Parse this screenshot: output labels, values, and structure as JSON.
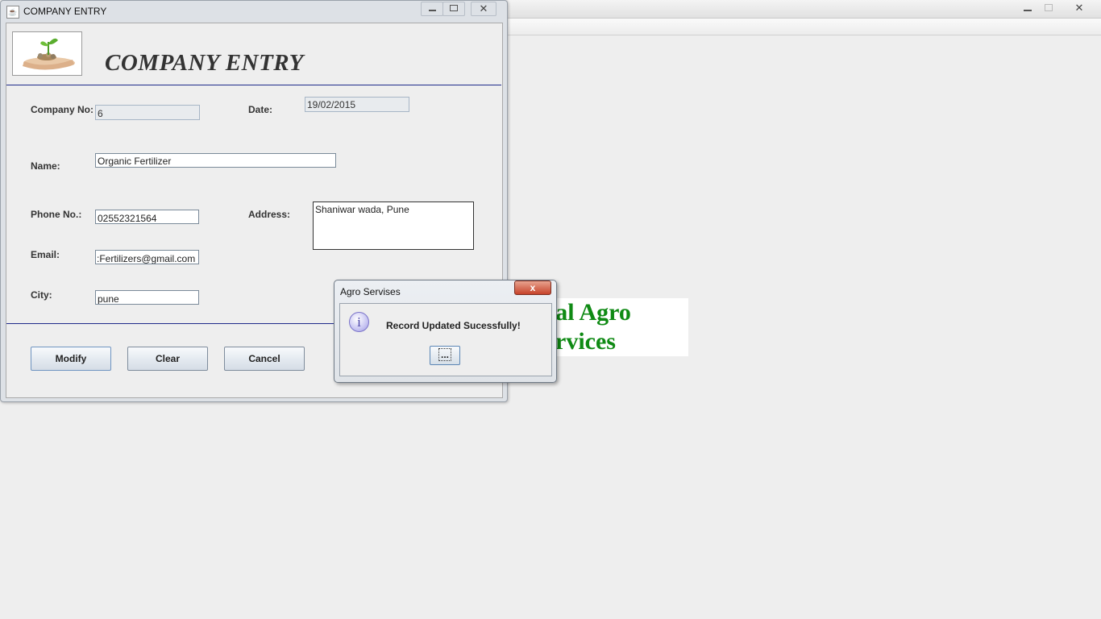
{
  "background_window": {
    "controls": [
      "minimize",
      "maximize",
      "close"
    ],
    "logo_text_lines": [
      "ersal Agro",
      "rvices"
    ],
    "logo_color": "#0f8a14"
  },
  "frame": {
    "title": "COMPANY ENTRY",
    "title_icon": "java-coffee-icon",
    "header_title": "COMPANY ENTRY",
    "header_image": "plant-in-hand-image",
    "separator_color": "#1e2a8a"
  },
  "form": {
    "company_no": {
      "label": "Company No:",
      "value": "6"
    },
    "date": {
      "label": "Date:",
      "value": "19/02/2015"
    },
    "name": {
      "label": "Name:",
      "value": "Organic Fertilizer"
    },
    "phone": {
      "label": "Phone No.:",
      "value": "02552321564"
    },
    "address": {
      "label": "Address:",
      "value": "Shaniwar wada, Pune"
    },
    "email": {
      "label": "Email:",
      "value": ":Fertilizers@gmail.com"
    },
    "city": {
      "label": "City:",
      "value": "pune"
    }
  },
  "buttons": {
    "modify": "Modify",
    "clear": "Clear",
    "cancel": "Cancel"
  },
  "dialog": {
    "title": "Agro Servises",
    "message": "Record Updated Sucessfully!",
    "ok_label": "...",
    "icon": "info-icon",
    "close_glyph": "x"
  }
}
